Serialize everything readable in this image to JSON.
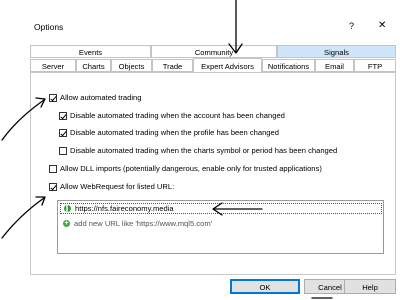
{
  "window": {
    "title": "Options",
    "help_glyph": "?",
    "close_glyph": "✕"
  },
  "tabs": {
    "row1": [
      {
        "label": "Events"
      },
      {
        "label": "Community"
      },
      {
        "label": "Signals"
      }
    ],
    "row2": [
      {
        "label": "Server"
      },
      {
        "label": "Charts"
      },
      {
        "label": "Objects"
      },
      {
        "label": "Trade"
      },
      {
        "label": "Expert Advisors",
        "active": true
      },
      {
        "label": "Notifications"
      },
      {
        "label": "Email"
      },
      {
        "label": "FTP"
      }
    ]
  },
  "options": {
    "allow_automated": {
      "label": "Allow automated trading",
      "checked": true
    },
    "disable_account": {
      "label": "Disable automated trading when the account has been changed",
      "checked": true
    },
    "disable_profile": {
      "label": "Disable automated trading when the profile has been changed",
      "checked": true
    },
    "disable_symbol": {
      "label": "Disable automated trading when the charts symbol or period has been changed",
      "checked": false
    },
    "allow_dll": {
      "label": "Allow DLL imports (potentially dangerous, enable only for trusted applications)",
      "checked": false
    },
    "allow_webrequest": {
      "label": "Allow WebRequest for listed URL:",
      "checked": true
    }
  },
  "url_list": {
    "items": [
      {
        "url": "https://nfs.faireconomy.media",
        "icon": "globe-icon"
      }
    ],
    "add_placeholder": "add new URL like 'https://www.mql5.com'"
  },
  "buttons": {
    "ok": "OK",
    "cancel": "Cancel",
    "help": "Help"
  },
  "colors": {
    "tab_highlight": "#cfe6fa",
    "focus_border": "#0078d7",
    "icon_green": "#2f9a3b"
  }
}
